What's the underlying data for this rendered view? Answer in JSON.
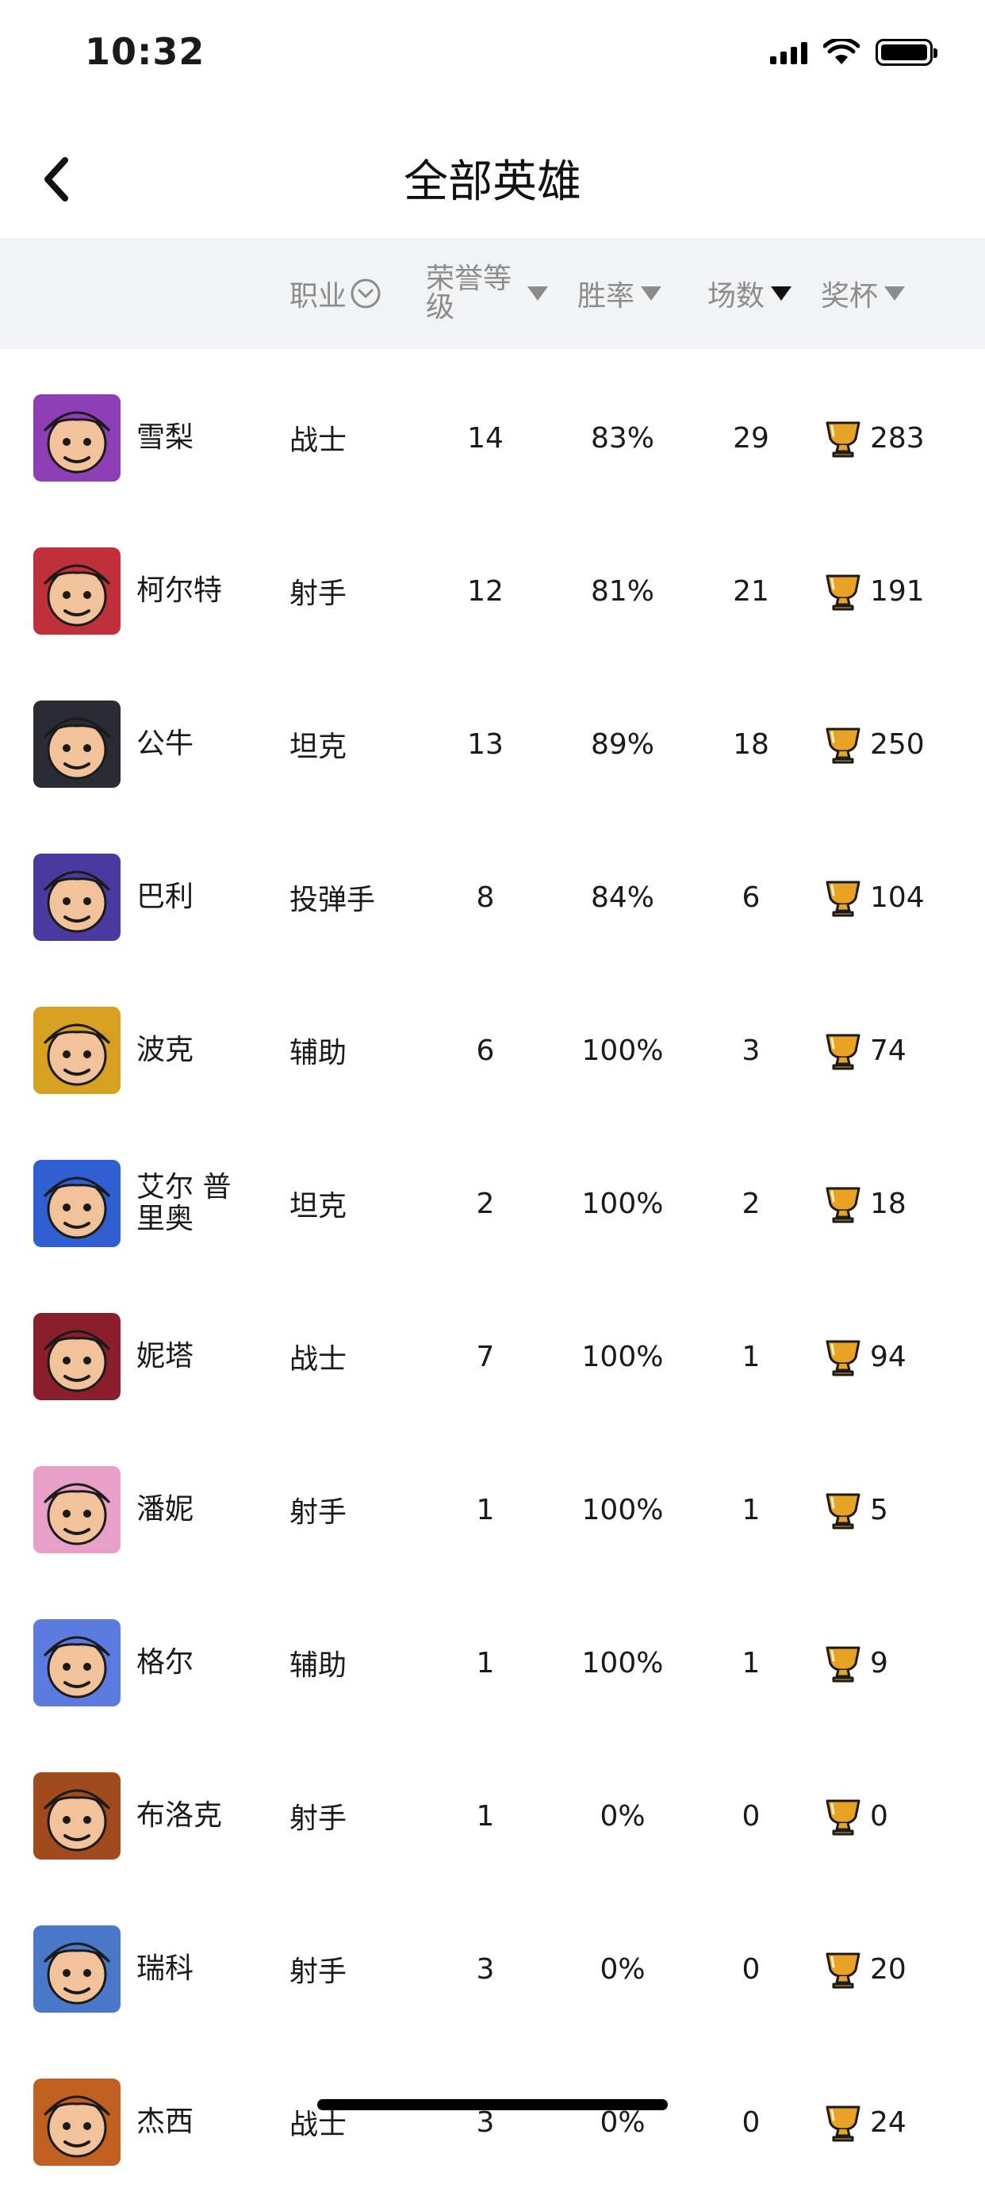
{
  "status_bar": {
    "time": "10:32"
  },
  "header": {
    "title": "全部英雄"
  },
  "table": {
    "columns": {
      "role": "职业",
      "honor": "荣誉等级",
      "winrate": "胜率",
      "games": "场数",
      "trophies": "奖杯"
    },
    "rows": [
      {
        "name": "雪梨",
        "role": "战士",
        "honor": "14",
        "winrate": "83%",
        "games": "29",
        "trophies": "283",
        "avatar_color": "#8e3fb5"
      },
      {
        "name": "柯尔特",
        "role": "射手",
        "honor": "12",
        "winrate": "81%",
        "games": "21",
        "trophies": "191",
        "avatar_color": "#c0303a"
      },
      {
        "name": "公牛",
        "role": "坦克",
        "honor": "13",
        "winrate": "89%",
        "games": "18",
        "trophies": "250",
        "avatar_color": "#2b2b35"
      },
      {
        "name": "巴利",
        "role": "投弹手",
        "honor": "8",
        "winrate": "84%",
        "games": "6",
        "trophies": "104",
        "avatar_color": "#4a3aa0"
      },
      {
        "name": "波克",
        "role": "辅助",
        "honor": "6",
        "winrate": "100%",
        "games": "3",
        "trophies": "74",
        "avatar_color": "#d8a020"
      },
      {
        "name": "艾尔 普里奥",
        "role": "坦克",
        "honor": "2",
        "winrate": "100%",
        "games": "2",
        "trophies": "18",
        "avatar_color": "#2f5fd0"
      },
      {
        "name": "妮塔",
        "role": "战士",
        "honor": "7",
        "winrate": "100%",
        "games": "1",
        "trophies": "94",
        "avatar_color": "#8a1e2a"
      },
      {
        "name": "潘妮",
        "role": "射手",
        "honor": "1",
        "winrate": "100%",
        "games": "1",
        "trophies": "5",
        "avatar_color": "#e8a0c8"
      },
      {
        "name": "格尔",
        "role": "辅助",
        "honor": "1",
        "winrate": "100%",
        "games": "1",
        "trophies": "9",
        "avatar_color": "#5b7be0"
      },
      {
        "name": "布洛克",
        "role": "射手",
        "honor": "1",
        "winrate": "0%",
        "games": "0",
        "trophies": "0",
        "avatar_color": "#a04a1e"
      },
      {
        "name": "瑞科",
        "role": "射手",
        "honor": "3",
        "winrate": "0%",
        "games": "0",
        "trophies": "20",
        "avatar_color": "#4a78c8"
      },
      {
        "name": "杰西",
        "role": "战士",
        "honor": "3",
        "winrate": "0%",
        "games": "0",
        "trophies": "24",
        "avatar_color": "#c06020"
      }
    ]
  },
  "colors": {
    "header_bg": "#f2f3f5",
    "header_text": "#8c8c8c",
    "trophy": "#e8a225"
  },
  "sort": {
    "active_column": "games"
  }
}
